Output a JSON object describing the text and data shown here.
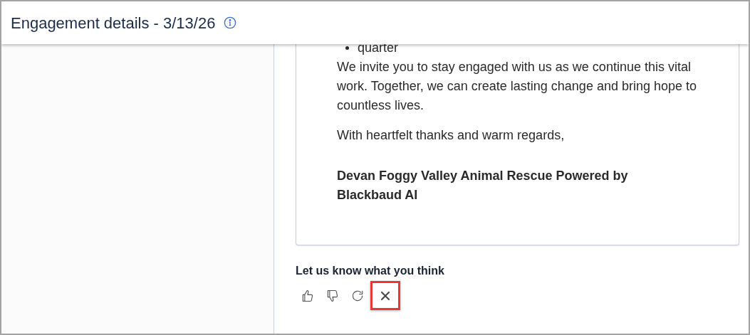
{
  "header": {
    "title": "Engagement details - 3/13/26"
  },
  "letter": {
    "bullets": [
      "quarter"
    ],
    "paragraphs": [
      "We invite you to stay engaged with us as we continue this vital work. Together, we can create lasting change and bring hope to countless lives.",
      "With heartfelt thanks and warm regards,"
    ],
    "signature": "Devan Foggy Valley Animal Rescue Powered by Blackbaud AI"
  },
  "feedback": {
    "prompt": "Let us know what you think",
    "actions": [
      {
        "kind": "thumbs-up",
        "highlighted": false
      },
      {
        "kind": "thumbs-down",
        "highlighted": false
      },
      {
        "kind": "regenerate",
        "highlighted": false
      },
      {
        "kind": "close",
        "highlighted": true
      }
    ]
  }
}
